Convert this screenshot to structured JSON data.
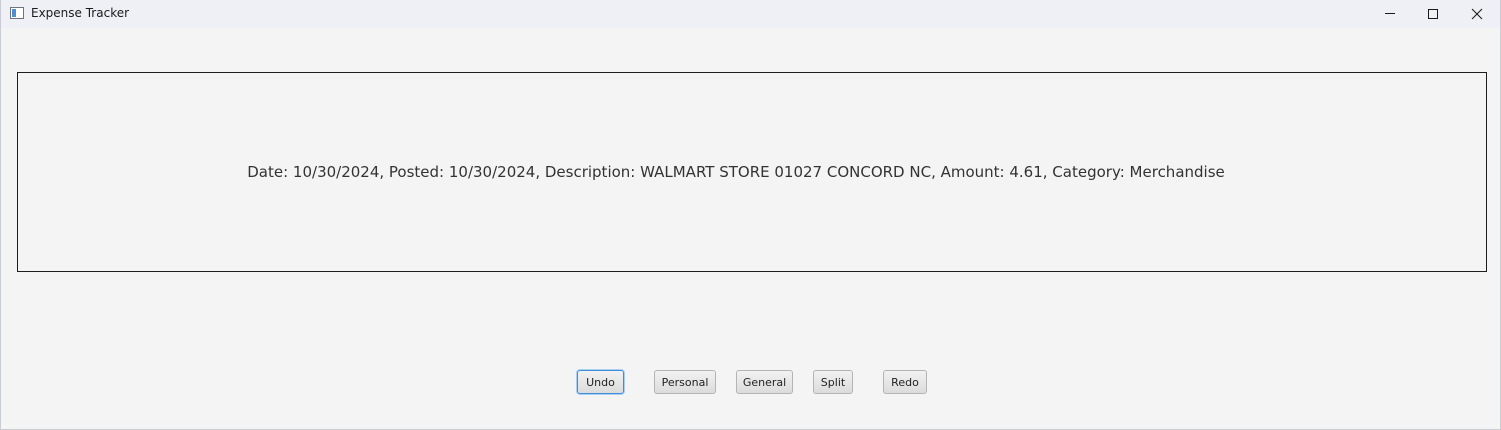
{
  "window": {
    "title": "Expense Tracker",
    "icons": {
      "app": "app-icon",
      "minimize": "minimize-icon",
      "maximize": "maximize-icon",
      "close": "close-icon"
    }
  },
  "transaction": {
    "summary": "Date: 10/30/2024, Posted: 10/30/2024, Description: WALMART STORE 01027 CONCORD NC, Amount: 4.61, Category: Merchandise"
  },
  "actions": {
    "undo": "Undo",
    "personal": "Personal",
    "general": "General",
    "split": "Split",
    "redo": "Redo"
  },
  "colors": {
    "background": "#f4f4f4",
    "titlebar": "#eef0f6",
    "focus_border": "#3f8fd8"
  }
}
